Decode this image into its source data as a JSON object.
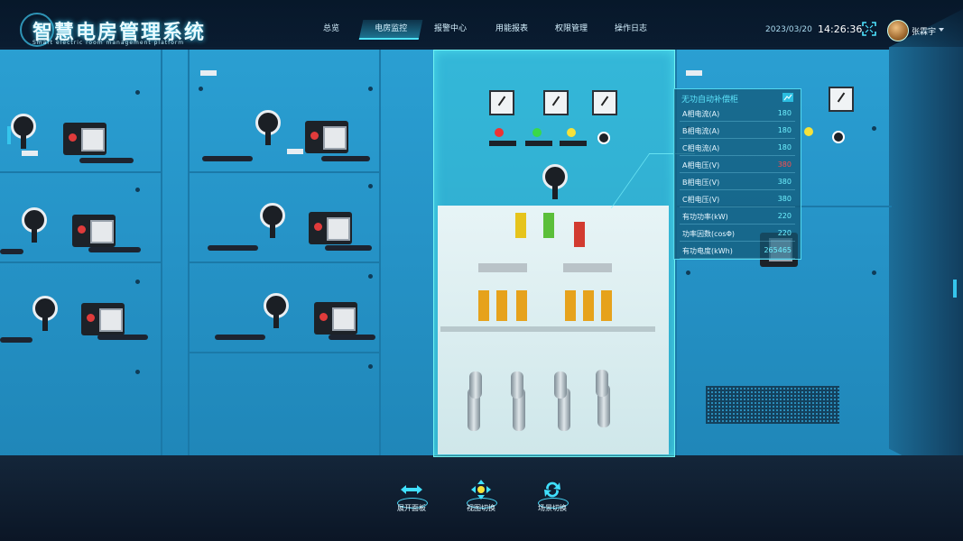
{
  "app": {
    "title": "智慧电房管理系统",
    "subtitle": "Smart electric room management platform"
  },
  "nav": {
    "items": [
      {
        "label": "总览",
        "active": false
      },
      {
        "label": "电房监控",
        "active": true
      },
      {
        "label": "报警中心",
        "active": false
      },
      {
        "label": "用能报表",
        "active": false
      },
      {
        "label": "权限管理",
        "active": false
      },
      {
        "label": "操作日志",
        "active": false
      }
    ]
  },
  "header": {
    "date": "2023/03/20",
    "time": "14:26:36",
    "user_name": "张霖宇",
    "fullscreen_icon": "fullscreen-icon"
  },
  "info_panel": {
    "title": "无功自动补偿柜",
    "rows": [
      {
        "label": "A相电流(A)",
        "value": "180",
        "alert": false
      },
      {
        "label": "B相电流(A)",
        "value": "180",
        "alert": false
      },
      {
        "label": "C相电流(A)",
        "value": "180",
        "alert": false
      },
      {
        "label": "A相电压(V)",
        "value": "380",
        "alert": true
      },
      {
        "label": "B相电压(V)",
        "value": "380",
        "alert": false
      },
      {
        "label": "C相电压(V)",
        "value": "380",
        "alert": false
      },
      {
        "label": "有功功率(kW)",
        "value": "220",
        "alert": false
      },
      {
        "label": "功率因数(cosΦ)",
        "value": "220",
        "alert": false
      },
      {
        "label": "有功电度(kWh)",
        "value": "265465",
        "alert": false
      }
    ]
  },
  "bottom_toolbar": {
    "buttons": [
      {
        "label": "展开面板",
        "icon": "expand-arrows-icon"
      },
      {
        "label": "视图切换",
        "icon": "view-switch-icon"
      },
      {
        "label": "场景切换",
        "icon": "scene-switch-icon"
      }
    ]
  },
  "colors": {
    "accent": "#4fe4ff",
    "cabinet": "#2592c6",
    "highlight_cabinet": "#48e6e6",
    "alert": "#ff4d4d"
  }
}
